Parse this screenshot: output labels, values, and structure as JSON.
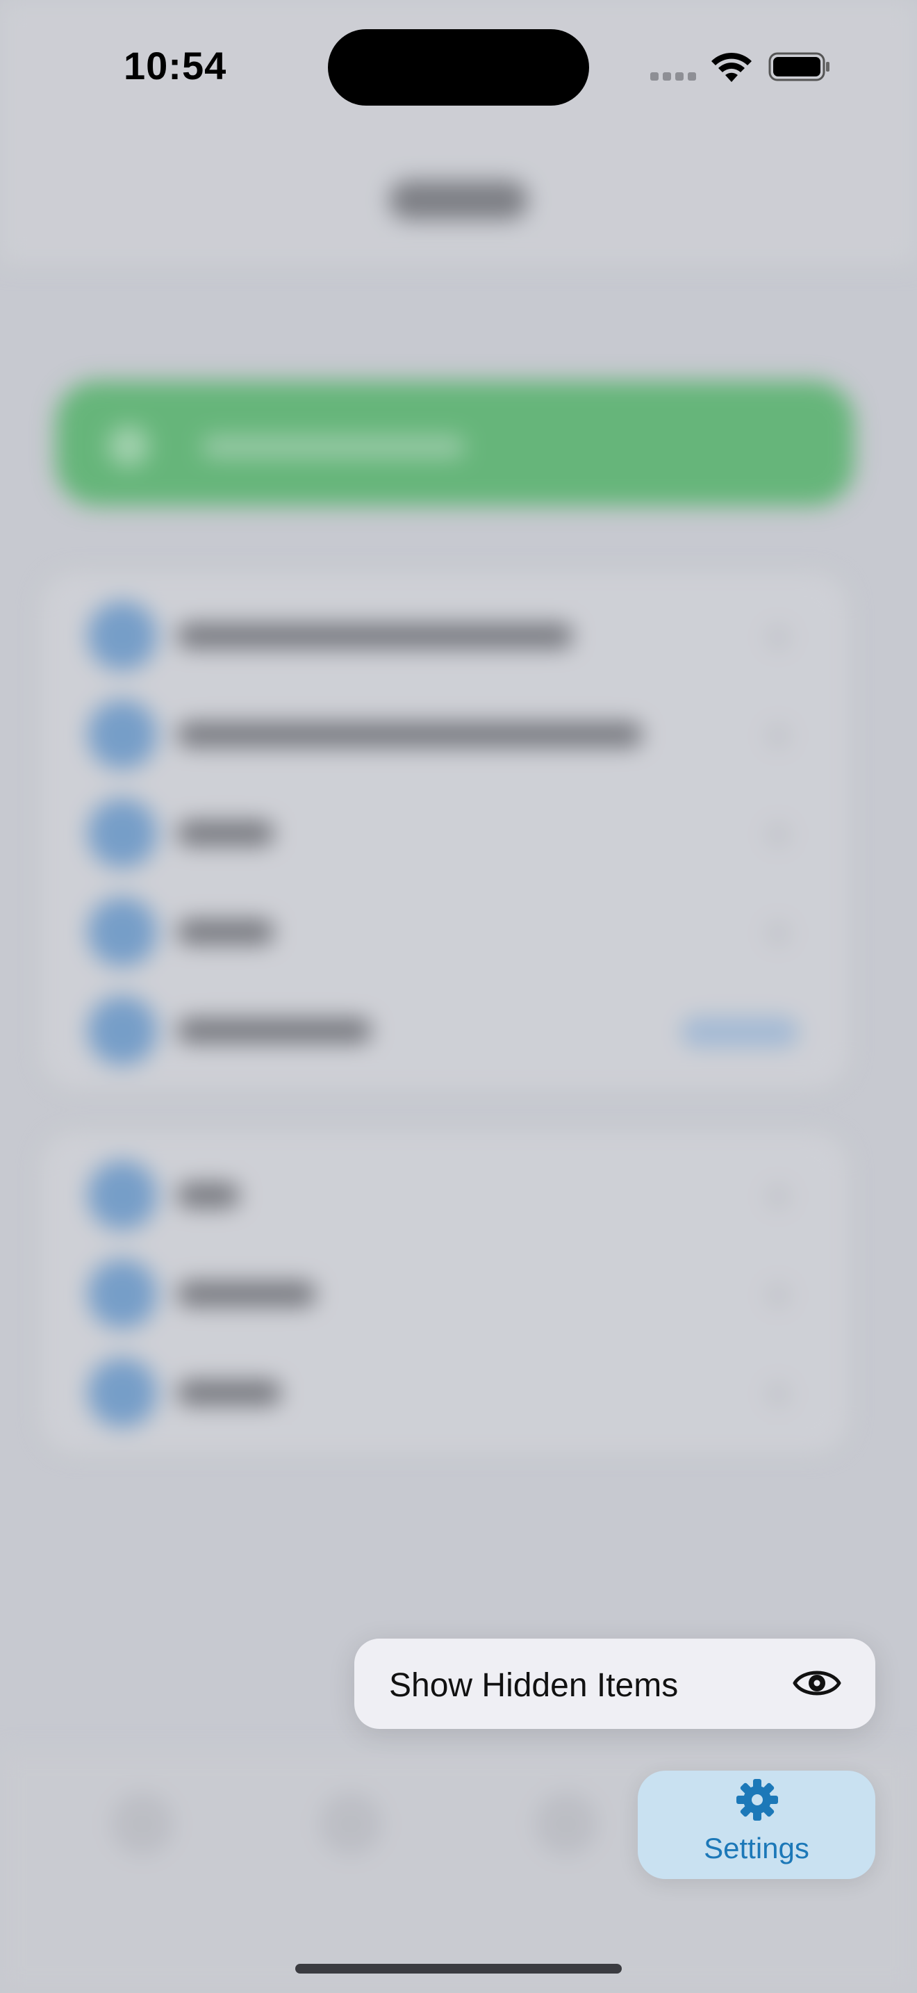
{
  "status_bar": {
    "time": "10:54"
  },
  "menu": {
    "items": [
      {
        "label": "Show Hidden Items",
        "icon": "eye-icon"
      }
    ]
  },
  "settings_button": {
    "label": "Settings",
    "icon": "gear-icon",
    "color": "#1c78b8"
  },
  "colors": {
    "accent_green": "#32aa4c",
    "accent_blue": "#4b86c4"
  }
}
